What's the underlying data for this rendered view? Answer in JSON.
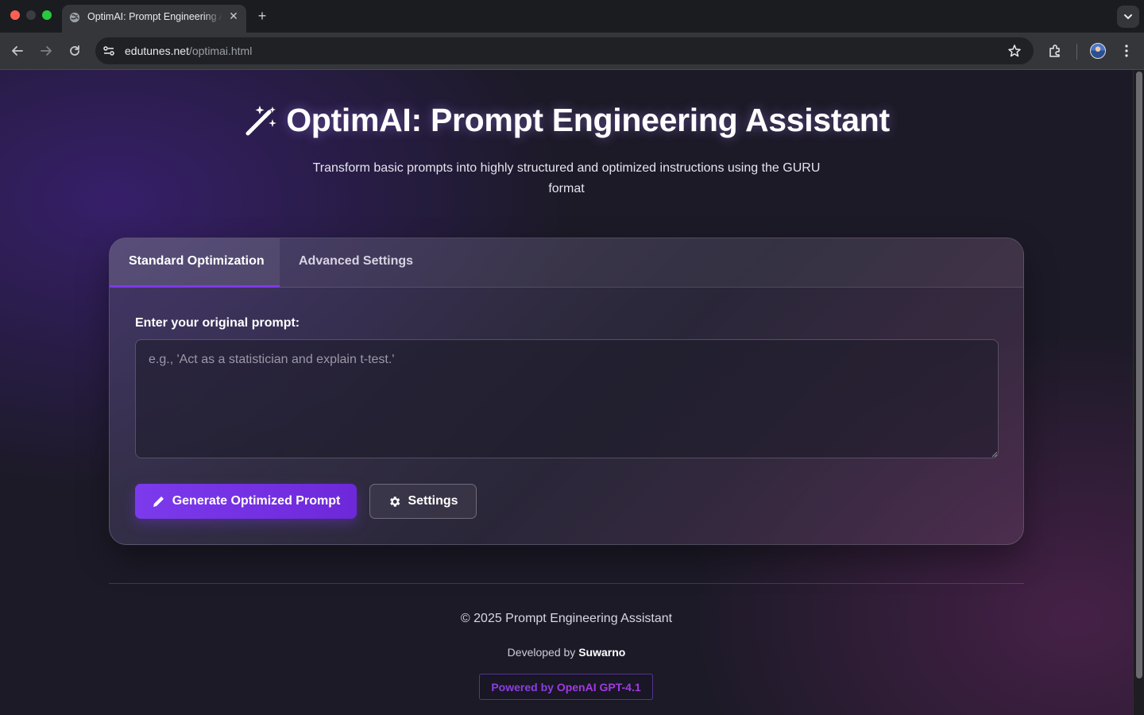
{
  "browser": {
    "tab_title": "OptimAI: Prompt Engineering Assistant",
    "tab_close_icon": "close-icon",
    "new_tab_icon": "plus-icon",
    "url_host": "edutunes.net",
    "url_path": "/optimai.html"
  },
  "hero": {
    "icon": "magic-wand-icon",
    "title": "OptimAI: Prompt Engineering Assistant",
    "subtitle": "Transform basic prompts into highly structured and optimized instructions using the GURU format"
  },
  "tabs": [
    {
      "label": "Standard Optimization",
      "active": true
    },
    {
      "label": "Advanced Settings",
      "active": false
    }
  ],
  "form": {
    "prompt_label": "Enter your original prompt:",
    "prompt_value": "",
    "prompt_placeholder": "e.g., 'Act as a statistician and explain t-test.'",
    "generate_label": "Generate Optimized Prompt",
    "generate_icon": "pencil-icon",
    "settings_label": "Settings",
    "settings_icon": "gear-icon"
  },
  "footer": {
    "copyright": "© 2025 Prompt Engineering Assistant",
    "developed_prefix": "Developed by",
    "developer": "Suwarno",
    "powered_prefix": "Powered by",
    "powered_model": "OpenAI GPT-4.1"
  },
  "colors": {
    "accent": "#7c3aed",
    "powered_text": "#8b3fe0"
  }
}
